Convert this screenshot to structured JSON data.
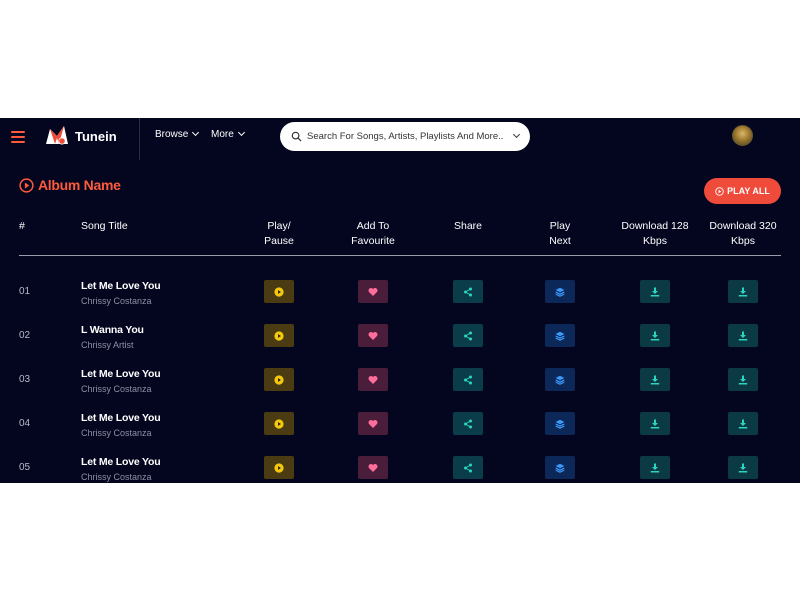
{
  "header": {
    "brand": "Tunein",
    "nav": [
      {
        "label": "Browse"
      },
      {
        "label": "More"
      }
    ],
    "search": {
      "placeholder": "Search For Songs, Artists, Playlists And More.."
    }
  },
  "album": {
    "name": "Album Name",
    "play_all_label": "PLAY ALL"
  },
  "table": {
    "columns": {
      "num": "#",
      "title": "Song Title",
      "play_pause": [
        "Play/",
        "Pause"
      ],
      "favourite": [
        "Add To",
        "Favourite"
      ],
      "share": "Share",
      "play_next": [
        "Play",
        "Next"
      ],
      "download_128": [
        "Download 128",
        "Kbps"
      ],
      "download_320": [
        "Download 320",
        "Kbps"
      ]
    },
    "rows": [
      {
        "num": "01",
        "title": "Let Me Love You",
        "artist": "Chrissy Costanza"
      },
      {
        "num": "02",
        "title": "L Wanna You",
        "artist": "Chrissy Artist"
      },
      {
        "num": "03",
        "title": "Let Me Love You",
        "artist": "Chrissy Costanza"
      },
      {
        "num": "04",
        "title": "Let Me Love You",
        "artist": "Chrissy Costanza"
      },
      {
        "num": "05",
        "title": "Let Me Love You",
        "artist": "Chrissy Costanza"
      }
    ]
  },
  "icons": {
    "menu": "hamburger-icon",
    "logo": "music-logo-icon",
    "search": "search-icon",
    "play": "play-icon",
    "favourite": "heart-icon",
    "share": "share-icon",
    "play_next": "layers-icon",
    "download": "download-icon"
  },
  "colors": {
    "background": "#04061f",
    "accent": "#ff5a3c",
    "play_icon": "#f6c90e",
    "heart_icon": "#ff6d9a",
    "share_icon": "#2dd4bf",
    "next_icon": "#3b9cff",
    "download_icon": "#2dd4bf"
  }
}
